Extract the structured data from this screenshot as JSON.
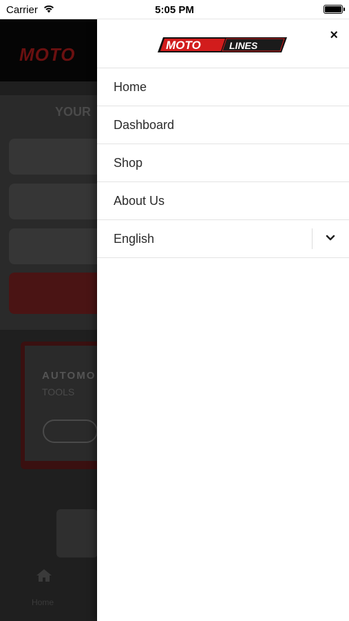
{
  "status_bar": {
    "carrier": "Carrier",
    "time": "5:05 PM"
  },
  "background": {
    "logo": "MOTO",
    "title": "YOUR",
    "banner_title": "AUTOMO",
    "banner_subtitle": "TOOLS",
    "tab_home": "Home"
  },
  "drawer": {
    "brand_primary": "MOTO",
    "brand_secondary": "LINES",
    "close_label": "×",
    "menu": [
      {
        "label": "Home"
      },
      {
        "label": "Dashboard"
      },
      {
        "label": "Shop"
      },
      {
        "label": "About Us"
      }
    ],
    "language": {
      "selected": "English"
    }
  },
  "colors": {
    "brand_red": "#d21c1c",
    "overlay_dark": "#1f1f1f"
  }
}
